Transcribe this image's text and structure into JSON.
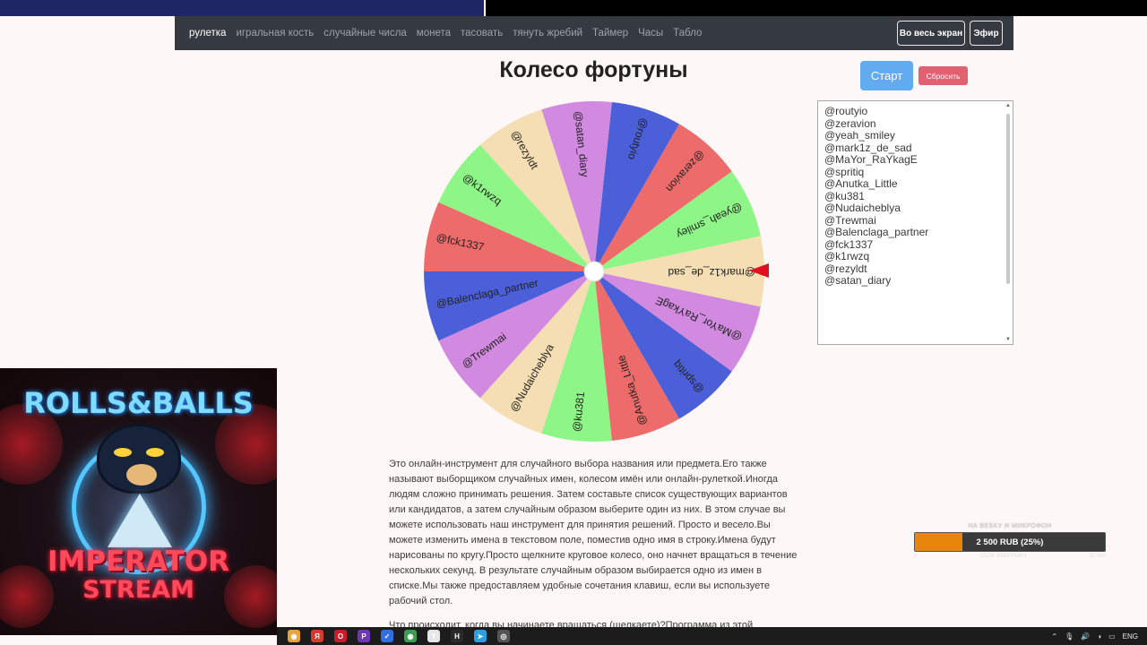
{
  "nav": {
    "items": [
      "рулетка",
      "игральная кость",
      "случайные числа",
      "монета",
      "тасовать",
      "тянуть жребий",
      "Таймер",
      "Часы",
      "Табло"
    ],
    "fullscreen_label": "Во весь экран",
    "live_label": "Эфир"
  },
  "page": {
    "title": "Колесо фортуны",
    "start_label": "Старт",
    "reset_label": "Сбросить"
  },
  "names_text": "@routyio\n@zeravion\n@yeah_smiley\n@mark1z_de_sad\n@MaYor_RaYkagE\n@spritiq\n@Anutka_Little\n@ku381\n@Nudaicheblya\n@Trewmai\n@Balenclaga_partner\n@fck1337\n@k1rwzq\n@rezyldt\n@satan_diary",
  "wheel": {
    "segments": [
      {
        "label": "@routyio",
        "color": "#4b5fd9"
      },
      {
        "label": "@zeravion",
        "color": "#ee6b6b"
      },
      {
        "label": "@yeah_smiley",
        "color": "#8ef686"
      },
      {
        "label": "@mark1z_de_sad",
        "color": "#f5deb3"
      },
      {
        "label": "@MaYor_RaYkagE",
        "color": "#d18ae0"
      },
      {
        "label": "@spritiq",
        "color": "#4b5fd9"
      },
      {
        "label": "@Anutka_Little",
        "color": "#ee6b6b"
      },
      {
        "label": "@ku381",
        "color": "#8ef686"
      },
      {
        "label": "@Nudaicheblya",
        "color": "#f5deb3"
      },
      {
        "label": "@Trewmai",
        "color": "#d18ae0"
      },
      {
        "label": "@Balenclaga_partner",
        "color": "#4b5fd9"
      },
      {
        "label": "@fck1337",
        "color": "#ee6b6b"
      },
      {
        "label": "@k1rwzq",
        "color": "#8ef686"
      },
      {
        "label": "@rezyldt",
        "color": "#f5deb3"
      },
      {
        "label": "@satan_diary",
        "color": "#d18ae0"
      }
    ],
    "pointer_color": "#e0101e"
  },
  "description": "Это онлайн-инструмент для случайного выбора названия или предмета.Его также называют выборщиком случайных имен, колесом имён или онлайн-рулеткой.Иногда людям сложно принимать решения. Затем составьте список существующих вариантов или кандидатов, а затем случайным образом выберите один из них. В этом случае вы можете использовать наш инструмент для принятия решений. Просто и весело.Вы можете изменить имена в текстовом поле, поместив одно имя в строку.Имена будут нарисованы по кругу.Просто щелкните круговое колесо, оно начнет вращаться в течение нескольких секунд. В результате случайным образом выбирается одно из имен в списке.Мы также предоставляем удобные сочетания клавиш, если вы используете рабочий стол.",
  "description_2": "Что происходит, когда вы начинаете вращаться (щелкаете)?Программа из этой",
  "stream": {
    "logo_top": "ROLLS&BALLS",
    "logo_mid": "IMPERATOR",
    "logo_bottom": "STREAM"
  },
  "goal": {
    "title": "НА ВЕБКУ И МИКРОФОН",
    "progress_text": "2 500 RUB (25%)",
    "progress_fraction": 0.25,
    "min": "0",
    "status": "СБОР ЗАВЕРШЕН",
    "max": "10 000"
  },
  "taskbar": {
    "icons": [
      {
        "name": "chrome-icon",
        "color": "#e8a33a",
        "glyph": "◉"
      },
      {
        "name": "yandex-icon",
        "color": "#d83a2e",
        "glyph": "Я"
      },
      {
        "name": "opera-icon",
        "color": "#cc1b2c",
        "glyph": "O"
      },
      {
        "name": "photoshop-icon",
        "color": "#6f36b5",
        "glyph": "P"
      },
      {
        "name": "check-icon",
        "color": "#2f6fe0",
        "glyph": "✓"
      },
      {
        "name": "chrome-2-icon",
        "color": "#3a9d52",
        "glyph": "◉"
      },
      {
        "name": "yandex-browser-icon",
        "color": "#e6e6e6",
        "glyph": "Y"
      },
      {
        "name": "h-app-icon",
        "color": "#2a2a2a",
        "glyph": "H"
      },
      {
        "name": "telegram-icon",
        "color": "#2b9fe0",
        "glyph": "➤"
      },
      {
        "name": "obs-icon",
        "color": "#555555",
        "glyph": "◎"
      }
    ],
    "lang": "ENG"
  }
}
